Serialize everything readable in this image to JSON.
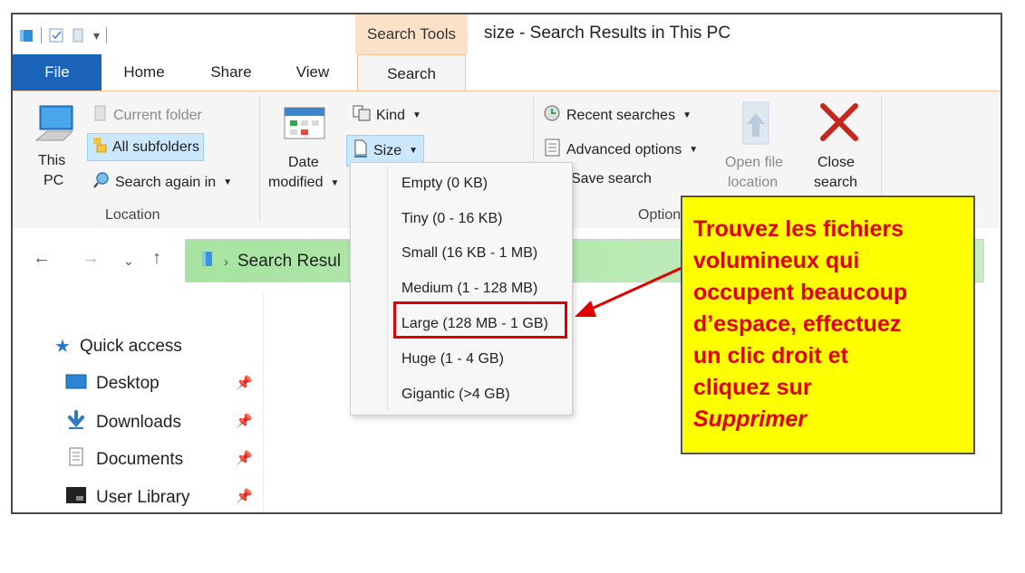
{
  "titlebar": {
    "context_tab": "Search Tools",
    "window_title": "size - Search Results in This PC"
  },
  "tabs": {
    "file": "File",
    "home": "Home",
    "share": "Share",
    "view": "View",
    "search": "Search"
  },
  "ribbon": {
    "this_pc_line1": "This",
    "this_pc_line2": "PC",
    "current_folder": "Current folder",
    "all_subfolders": "All subfolders",
    "search_again_in": "Search again in",
    "location_label": "Location",
    "date_line1": "Date",
    "date_line2": "modified",
    "kind": "Kind",
    "size": "Size",
    "recent_searches": "Recent searches",
    "advanced_options": "Advanced options",
    "save_search": "Save search",
    "options_label": "Option",
    "open_file_line1": "Open file",
    "open_file_line2": "location",
    "close_line1": "Close",
    "close_line2": "search"
  },
  "navbar": {
    "address_text": "Search Resul"
  },
  "navpane": {
    "items": [
      {
        "label": "Quick access"
      },
      {
        "label": "Desktop"
      },
      {
        "label": "Downloads"
      },
      {
        "label": "Documents"
      },
      {
        "label": "User Library"
      }
    ]
  },
  "size_menu": {
    "items": [
      {
        "label": "Empty (0 KB)"
      },
      {
        "label": "Tiny (0 - 16 KB)"
      },
      {
        "label": "Small (16 KB - 1 MB)"
      },
      {
        "label": "Medium (1 - 128 MB)"
      },
      {
        "label": "Large (128 MB - 1 GB)"
      },
      {
        "label": "Huge (1 - 4 GB)"
      },
      {
        "label": "Gigantic (>4 GB)"
      }
    ],
    "highlighted_index": 4
  },
  "callout": {
    "line1": "Trouvez les fichiers",
    "line2": "volumineux qui",
    "line3": "occupent beaucoup",
    "line4": "d’espace, effectuez",
    "line5": "un clic droit et",
    "line6": "cliquez sur",
    "line7": "Supprimer"
  },
  "colors": {
    "accent_file_tab": "#1a63b8",
    "search_tools": "#fbe1c6",
    "callout_bg": "#ffff00",
    "callout_text": "#e00000",
    "address_bar": "#a6e3a0"
  }
}
